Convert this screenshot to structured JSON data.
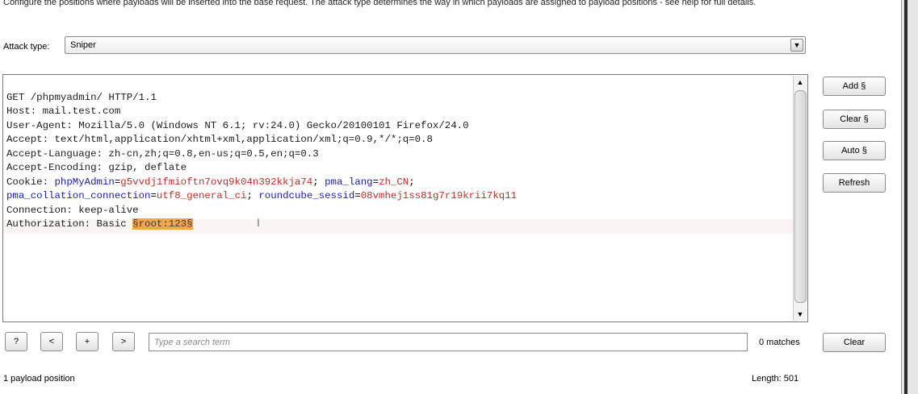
{
  "description": "Configure the positions where payloads will be inserted into the base request. The attack type determines the way in which payloads are assigned to payload positions - see help for full details.",
  "attack": {
    "label": "Attack type:",
    "selected": "Sniper"
  },
  "request_lines": {
    "l1": "GET /phpmyadmin/ HTTP/1.1",
    "l2": "Host: mail.test.com",
    "l3": "User-Agent: Mozilla/5.0 (Windows NT 6.1; rv:24.0) Gecko/20100101 Firefox/24.0",
    "l4": "Accept: text/html,application/xhtml+xml,application/xml;q=0.9,*/*;q=0.8",
    "l5": "Accept-Language: zh-cn,zh;q=0.8,en-us;q=0.5,en;q=0.3",
    "l6": "Accept-Encoding: gzip, deflate",
    "l7_prefix": "Cookie: ",
    "cookie1_name": "phpMyAdmin",
    "cookie1_value": "g5vvdj1fmioftn7ovq9k04n392kkja74",
    "cookie2_name": "pma_lang",
    "cookie2_value": "zh_CN",
    "cookie3_name": "pma_collation_connection",
    "cookie3_value": "utf8_general_ci",
    "cookie4_name": "roundcube_sessid",
    "cookie4_value": "08vmhej1ss81g7r19krii7kq11",
    "l9": "Connection: keep-alive",
    "l10_prefix": "Authorization: Basic ",
    "payload": "§root:123§"
  },
  "side_buttons": {
    "add": "Add §",
    "clear": "Clear §",
    "auto": "Auto §",
    "refresh": "Refresh"
  },
  "search": {
    "help": "?",
    "prev": "<",
    "add": "+",
    "next": ">",
    "placeholder": "Type a search term",
    "matches": "0 matches",
    "clear": "Clear"
  },
  "status": {
    "payload_positions": "1 payload position",
    "length": "Length: 501"
  }
}
